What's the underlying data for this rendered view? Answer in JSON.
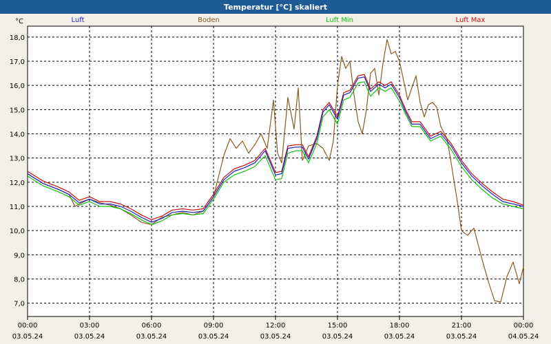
{
  "window": {
    "title": "Temperatur [°C] skaliert"
  },
  "chart_data": {
    "type": "line",
    "title": "Temperatur [°C] skaliert",
    "ylabel": "°C",
    "xlim": [
      0,
      24
    ],
    "ylim": [
      6.45,
      18.45
    ],
    "grid": true,
    "legend_placement": "top",
    "yticks": [
      "7,0",
      "8,0",
      "9,0",
      "10,0",
      "11,0",
      "12,0",
      "13,0",
      "14,0",
      "15,0",
      "16,0",
      "17,0",
      "18,0"
    ],
    "ytick_values": [
      7,
      8,
      9,
      10,
      11,
      12,
      13,
      14,
      15,
      16,
      17,
      18
    ],
    "xticks": [
      {
        "x": 0,
        "time": "00:00",
        "date": "03.05.24"
      },
      {
        "x": 3,
        "time": "03:00",
        "date": "03.05.24"
      },
      {
        "x": 6,
        "time": "06:00",
        "date": "03.05.24"
      },
      {
        "x": 9,
        "time": "09:00",
        "date": "03.05.24"
      },
      {
        "x": 12,
        "time": "12:00",
        "date": "03.05.24"
      },
      {
        "x": 15,
        "time": "15:00",
        "date": "03.05.24"
      },
      {
        "x": 18,
        "time": "18:00",
        "date": "03.05.24"
      },
      {
        "x": 21,
        "time": "21:00",
        "date": "03.05.24"
      },
      {
        "x": 24,
        "time": "00:00",
        "date": "04.05.24"
      }
    ],
    "series": [
      {
        "name": "Luft",
        "color": "#2020c0",
        "x": [
          0,
          0.75,
          1.5,
          2,
          2.5,
          3,
          3.5,
          4,
          4.5,
          5,
          5.5,
          6,
          6.5,
          7,
          7.5,
          8,
          8.5,
          9,
          9.5,
          10,
          10.5,
          11,
          11.5,
          12,
          12.3,
          12.6,
          13,
          13.3,
          13.6,
          14,
          14.3,
          14.6,
          15,
          15.3,
          15.6,
          16,
          16.3,
          16.6,
          17,
          17.3,
          17.6,
          18,
          18.3,
          18.6,
          19,
          19.5,
          20,
          20.5,
          21,
          21.5,
          22,
          22.5,
          23,
          23.5,
          24
        ],
        "y": [
          12.35,
          11.95,
          11.7,
          11.5,
          11.15,
          11.3,
          11.1,
          11.1,
          11.0,
          10.8,
          10.55,
          10.35,
          10.5,
          10.75,
          10.8,
          10.75,
          10.8,
          11.4,
          12.1,
          12.45,
          12.6,
          12.8,
          13.3,
          12.3,
          12.35,
          13.4,
          13.45,
          13.45,
          12.95,
          13.8,
          14.9,
          15.2,
          14.6,
          15.6,
          15.7,
          16.3,
          16.35,
          15.75,
          16.05,
          15.9,
          16.05,
          15.5,
          14.9,
          14.4,
          14.4,
          13.8,
          14.0,
          13.5,
          12.8,
          12.25,
          11.85,
          11.5,
          11.2,
          11.1,
          11.0
        ]
      },
      {
        "name": "Boden",
        "color": "#8a5a1e",
        "x": [
          0,
          0.75,
          1.5,
          2,
          2.3,
          2.5,
          3,
          3.5,
          4,
          4.5,
          5,
          5.5,
          6,
          6.5,
          7,
          7.5,
          8,
          8.5,
          9,
          9.5,
          9.8,
          10.1,
          10.4,
          10.7,
          11,
          11.3,
          11.6,
          11.9,
          12.1,
          12.3,
          12.6,
          12.9,
          13.1,
          13.3,
          13.6,
          14,
          14.3,
          14.6,
          14.8,
          15,
          15.2,
          15.4,
          15.6,
          15.8,
          16,
          16.2,
          16.4,
          16.6,
          16.8,
          17,
          17.2,
          17.4,
          17.6,
          17.8,
          18,
          18.2,
          18.4,
          18.6,
          18.8,
          19,
          19.2,
          19.4,
          19.6,
          19.8,
          20,
          20.3,
          20.5,
          20.8,
          21,
          21.3,
          21.6,
          22,
          22.3,
          22.6,
          22.9,
          23.2,
          23.5,
          23.8,
          24
        ],
        "y": [
          12.35,
          11.95,
          11.7,
          11.5,
          11.0,
          11.1,
          11.3,
          11.15,
          11.05,
          10.9,
          10.65,
          10.35,
          10.25,
          10.55,
          10.65,
          10.75,
          10.65,
          10.8,
          11.4,
          13.1,
          13.8,
          13.4,
          13.7,
          13.2,
          13.55,
          14.0,
          13.4,
          15.4,
          13.2,
          12.8,
          15.5,
          14.2,
          15.9,
          12.9,
          13.5,
          13.6,
          13.4,
          12.9,
          13.7,
          16.0,
          17.2,
          16.7,
          17.0,
          15.6,
          14.5,
          14.0,
          15.0,
          16.5,
          16.7,
          15.6,
          16.9,
          17.9,
          17.3,
          17.4,
          17.0,
          16.2,
          15.4,
          15.9,
          16.4,
          15.3,
          14.7,
          15.2,
          15.3,
          15.1,
          14.3,
          13.8,
          12.8,
          11.2,
          10.0,
          9.8,
          10.1,
          8.8,
          7.9,
          7.1,
          7.05,
          8.1,
          8.7,
          7.8,
          8.5
        ]
      },
      {
        "name": "Luft Min",
        "color": "#10c010",
        "x": [
          0,
          0.75,
          1.5,
          2,
          2.5,
          3,
          3.5,
          4,
          4.5,
          5,
          5.5,
          6,
          6.5,
          7,
          7.5,
          8,
          8.5,
          9,
          9.5,
          10,
          10.5,
          11,
          11.5,
          12,
          12.3,
          12.6,
          13,
          13.3,
          13.6,
          14,
          14.3,
          14.6,
          15,
          15.3,
          15.6,
          16,
          16.3,
          16.6,
          17,
          17.3,
          17.6,
          18,
          18.3,
          18.6,
          19,
          19.5,
          20,
          20.5,
          21,
          21.5,
          22,
          22.5,
          23,
          23.5,
          24
        ],
        "y": [
          12.25,
          11.85,
          11.6,
          11.4,
          11.05,
          11.2,
          11.0,
          11.0,
          10.9,
          10.7,
          10.45,
          10.25,
          10.4,
          10.65,
          10.7,
          10.65,
          10.7,
          11.3,
          12.0,
          12.3,
          12.45,
          12.65,
          13.1,
          12.1,
          12.15,
          13.2,
          13.3,
          13.3,
          12.8,
          13.6,
          14.7,
          15.0,
          14.4,
          15.4,
          15.5,
          16.1,
          16.15,
          15.55,
          15.9,
          15.75,
          15.9,
          15.35,
          14.8,
          14.3,
          14.3,
          13.7,
          13.9,
          13.35,
          12.65,
          12.1,
          11.7,
          11.35,
          11.1,
          11.0,
          10.9
        ]
      },
      {
        "name": "Luft Max",
        "color": "#c01010",
        "x": [
          0,
          0.75,
          1.5,
          2,
          2.5,
          3,
          3.5,
          4,
          4.5,
          5,
          5.5,
          6,
          6.5,
          7,
          7.5,
          8,
          8.5,
          9,
          9.5,
          10,
          10.5,
          11,
          11.5,
          12,
          12.3,
          12.6,
          13,
          13.3,
          13.6,
          14,
          14.3,
          14.6,
          15,
          15.3,
          15.6,
          16,
          16.3,
          16.6,
          17,
          17.3,
          17.6,
          18,
          18.3,
          18.6,
          19,
          19.5,
          20,
          20.5,
          21,
          21.5,
          22,
          22.5,
          23,
          23.5,
          24
        ],
        "y": [
          12.45,
          12.05,
          11.8,
          11.6,
          11.25,
          11.4,
          11.2,
          11.2,
          11.1,
          10.9,
          10.65,
          10.45,
          10.6,
          10.85,
          10.9,
          10.85,
          10.9,
          11.5,
          12.2,
          12.55,
          12.7,
          12.9,
          13.4,
          12.4,
          12.45,
          13.5,
          13.55,
          13.55,
          13.05,
          13.9,
          15.0,
          15.3,
          14.7,
          15.7,
          15.8,
          16.4,
          16.45,
          15.85,
          16.15,
          16.0,
          16.15,
          15.6,
          15.0,
          14.5,
          14.5,
          13.9,
          14.1,
          13.6,
          12.9,
          12.35,
          11.95,
          11.6,
          11.3,
          11.2,
          11.05
        ]
      }
    ]
  }
}
